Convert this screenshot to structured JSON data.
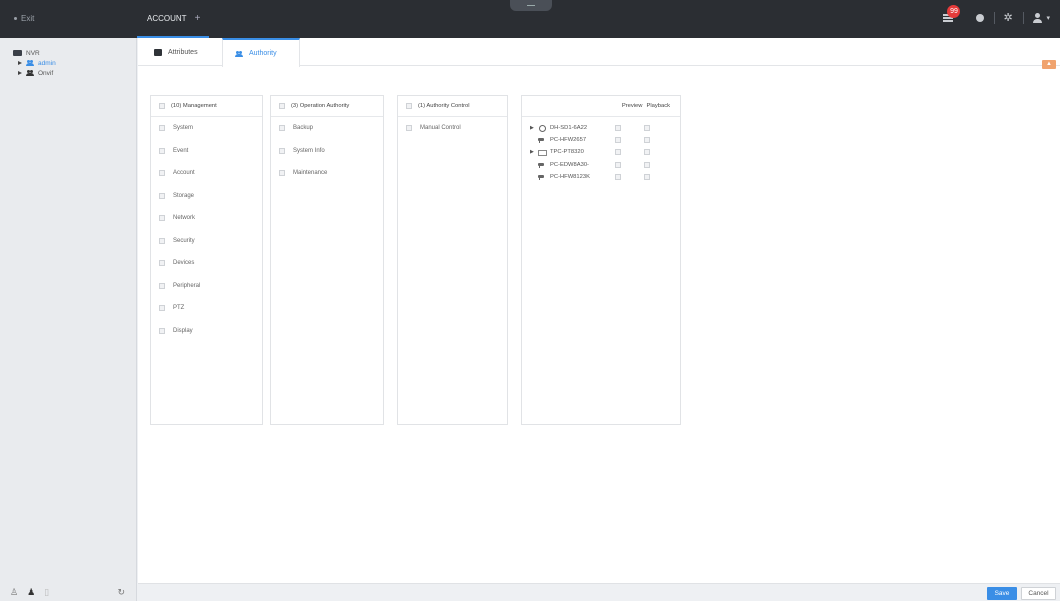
{
  "topbar": {
    "exit_label": "Exit",
    "tab_label": "ACCOUNT",
    "tab_add": "+",
    "alarm_count": "99"
  },
  "sidebar": {
    "root": "NVR",
    "users": [
      "admin",
      "Onvif"
    ]
  },
  "tabs": {
    "attributes": "Attributes",
    "authority": "Authority"
  },
  "panels": {
    "management": {
      "title": "(10) Management",
      "items": [
        "System",
        "Event",
        "Account",
        "Storage",
        "Network",
        "Security",
        "Devices",
        "Peripheral",
        "PTZ",
        "Display"
      ]
    },
    "operation": {
      "title": "(3) Operation Authority",
      "items": [
        "Backup",
        "System Info",
        "Maintenance"
      ]
    },
    "control": {
      "title": "(1) Authority Control",
      "items": [
        "Manual Control"
      ]
    },
    "devices": {
      "preview_label": "Preview",
      "playback_label": "Playback",
      "rows": [
        {
          "name": "DH-SD1-6A22",
          "icon": "dome-camera-icon",
          "expandable": true
        },
        {
          "name": "PC-HFW2657",
          "icon": "bullet-camera-icon",
          "expandable": false
        },
        {
          "name": "TPC-PT8320",
          "icon": "thermal-device-icon",
          "expandable": true
        },
        {
          "name": "PC-EDW8A30-",
          "icon": "bullet-camera-icon",
          "expandable": false
        },
        {
          "name": "PC-HFW8123K",
          "icon": "bullet-camera-icon",
          "expandable": false
        }
      ]
    }
  },
  "footer": {
    "save_label": "Save",
    "cancel_label": "Cancel"
  },
  "colors": {
    "accent": "#3a8ee6",
    "topbar": "#2b2e33",
    "badge": "#e63b3b"
  }
}
